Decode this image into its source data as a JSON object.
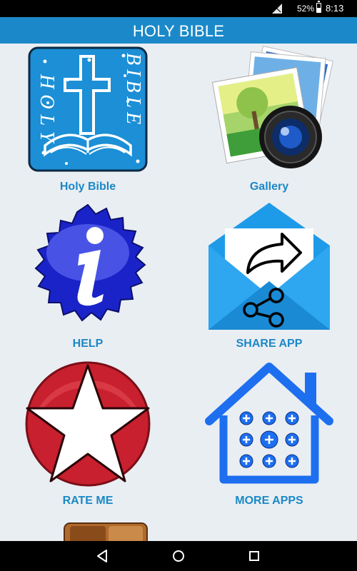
{
  "status_bar": {
    "battery_percent": "52%",
    "battery_level": 0.52,
    "time": "8:13 pm",
    "icons": [
      "signal-icon",
      "battery-icon"
    ]
  },
  "header": {
    "title": "HOLY BIBLE"
  },
  "menu": {
    "items": [
      {
        "label": "Holy Bible",
        "icon": "holy-bible-icon"
      },
      {
        "label": "Gallery",
        "icon": "gallery-icon"
      },
      {
        "label": "HELP",
        "icon": "help-icon"
      },
      {
        "label": "SHARE APP",
        "icon": "share-app-icon"
      },
      {
        "label": "RATE ME",
        "icon": "rate-me-icon"
      },
      {
        "label": "MORE APPS",
        "icon": "more-apps-icon"
      }
    ]
  },
  "bible_icon": {
    "text_left": "HOLY",
    "text_right": "BIBLE"
  },
  "nav_bar": {
    "icons": [
      "back-icon",
      "home-icon",
      "recents-icon"
    ]
  },
  "colors": {
    "header_bg": "#1b89c9",
    "label_text": "#1b88c6",
    "background": "#e9eef3",
    "bible_blue": "#1c8fd6",
    "help_blue": "#1a23c8",
    "mail_blue": "#1e9be8",
    "rate_red": "#c8202e",
    "house_blue": "#1d6ff0"
  }
}
